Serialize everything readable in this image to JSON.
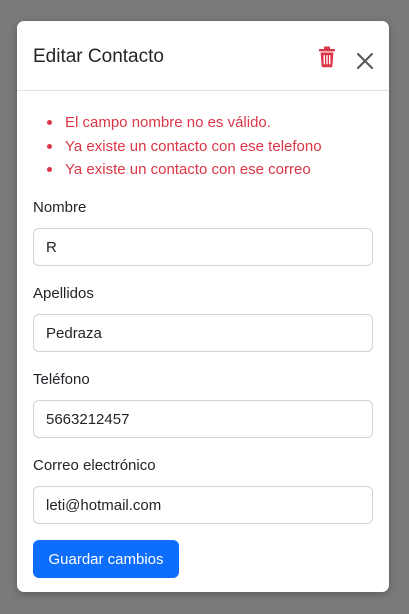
{
  "modal": {
    "title": "Editar Contacto",
    "trash_icon": "trash-icon",
    "close_icon": "close-icon",
    "accent_color": "#0d6efd",
    "error_color": "#dc3545"
  },
  "errors": [
    "El campo nombre no es válido.",
    "Ya existe un contacto con ese telefono",
    "Ya existe un contacto con ese correo"
  ],
  "form": {
    "nombre": {
      "label": "Nombre",
      "value": "R"
    },
    "apellidos": {
      "label": "Apellidos",
      "value": "Pedraza"
    },
    "telefono": {
      "label": "Teléfono",
      "value": "5663212457"
    },
    "correo": {
      "label": "Correo electrónico",
      "value": "leti@hotmail.com"
    },
    "save_label": "Guardar cambios"
  }
}
